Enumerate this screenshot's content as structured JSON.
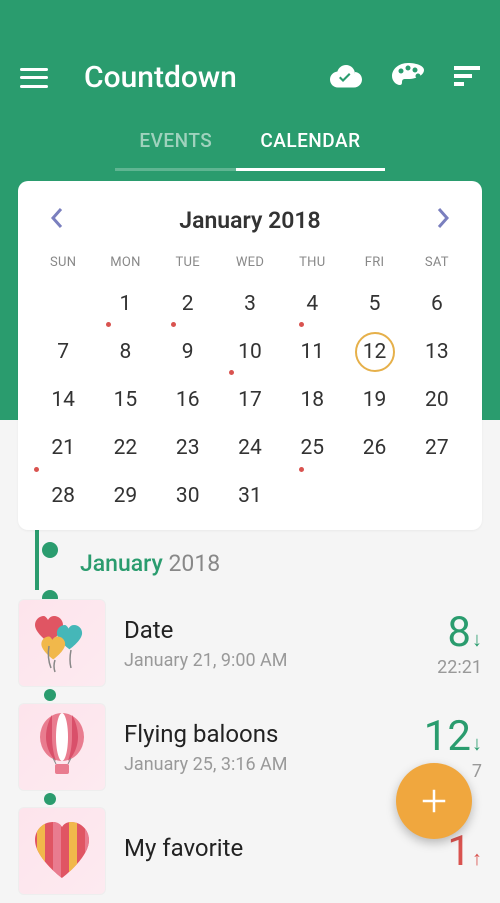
{
  "app": {
    "title": "Countdown"
  },
  "tabs": {
    "events": "EVENTS",
    "calendar": "CALENDAR"
  },
  "calendar": {
    "title": "January 2018",
    "dow": [
      "SUN",
      "MON",
      "TUE",
      "WED",
      "THU",
      "FRI",
      "SAT"
    ],
    "weeks": [
      [
        null,
        1,
        2,
        3,
        4,
        5,
        6
      ],
      [
        7,
        8,
        9,
        10,
        11,
        12,
        13
      ],
      [
        14,
        15,
        16,
        17,
        18,
        19,
        20
      ],
      [
        21,
        22,
        23,
        24,
        25,
        26,
        27
      ],
      [
        28,
        29,
        30,
        31,
        null,
        null,
        null
      ]
    ],
    "today": 12,
    "dotted": [
      1,
      2,
      4,
      10,
      21,
      25
    ]
  },
  "sectionHeader": {
    "month": "January",
    "year": "2018"
  },
  "events": [
    {
      "title": "Date",
      "sub": "January 21, 9:00 AM",
      "count": "8",
      "arrow": "↓",
      "countColor": "green",
      "time": "22:21",
      "iconGradient": "#fbd3e0"
    },
    {
      "title": "Flying baloons",
      "sub": "January 25, 3:16 AM",
      "count": "12",
      "arrow": "↓",
      "countColor": "green",
      "time": "7",
      "iconGradient": "#fbd3e0"
    },
    {
      "title": "My favorite",
      "sub": "",
      "count": "1",
      "arrow": "↑",
      "countColor": "red",
      "time": "",
      "iconGradient": "#fbd3e0"
    }
  ]
}
